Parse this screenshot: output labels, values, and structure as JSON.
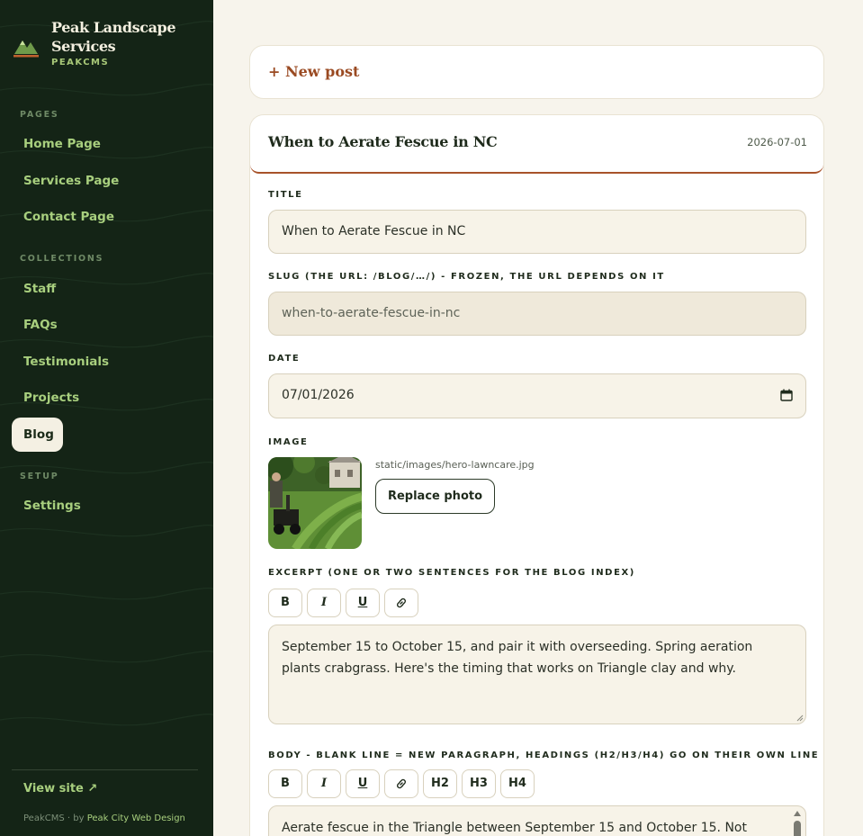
{
  "brand": {
    "name": "Peak Landscape Services",
    "sub": "PEAKCMS"
  },
  "sidebar": {
    "sections": [
      {
        "label": "PAGES"
      },
      {
        "label": "COLLECTIONS"
      },
      {
        "label": "SETUP"
      }
    ],
    "items": [
      {
        "label": "Home Page"
      },
      {
        "label": "Services Page"
      },
      {
        "label": "Contact Page"
      },
      {
        "label": "Staff"
      },
      {
        "label": "FAQs"
      },
      {
        "label": "Testimonials"
      },
      {
        "label": "Projects"
      },
      {
        "label": "Blog",
        "active": true
      },
      {
        "label": "Settings"
      }
    ],
    "view_site": "View site ↗",
    "footer_prefix": "PeakCMS · by ",
    "footer_link": "Peak City Web Design"
  },
  "new_post": {
    "label": "+ New post"
  },
  "editor": {
    "title": "When to Aerate Fescue in NC",
    "date": "2026-07-01",
    "fields": {
      "title_label": "TITLE",
      "title_value": "When to Aerate Fescue in NC",
      "slug_label": "SLUG (THE URL: /BLOG/…/) - FROZEN, THE URL DEPENDS ON IT",
      "slug_value": "when-to-aerate-fescue-in-nc",
      "date_label": "DATE",
      "date_value": "07/01/2026",
      "image_label": "IMAGE",
      "image_path": "static/images/hero-lawncare.jpg",
      "replace_photo": "Replace photo",
      "excerpt_label": "EXCERPT (ONE OR TWO SENTENCES FOR THE BLOG INDEX)",
      "excerpt_value": "September 15 to October 15, and pair it with overseeding. Spring aeration plants crabgrass. Here's the timing that works on Triangle clay and why.",
      "body_label": "BODY - BLANK LINE = NEW PARAGRAPH, HEADINGS (H2/H3/H4) GO ON THEIR OWN LINE",
      "body_value": "Aerate fescue in the Triangle between September 15 and October 15. Not"
    },
    "toolbar": {
      "bold": "B",
      "italic": "I",
      "underline": "U",
      "h2": "H2",
      "h3": "H3",
      "h4": "H4"
    }
  },
  "colors": {
    "sidebar_bg": "#142416",
    "accent": "#a8532a",
    "nav_text": "#a8cf7e",
    "page_bg": "#f7f4ec"
  },
  "icons": [
    "mountain-logo-icon",
    "link-icon",
    "calendar-icon",
    "external-link-icon"
  ]
}
